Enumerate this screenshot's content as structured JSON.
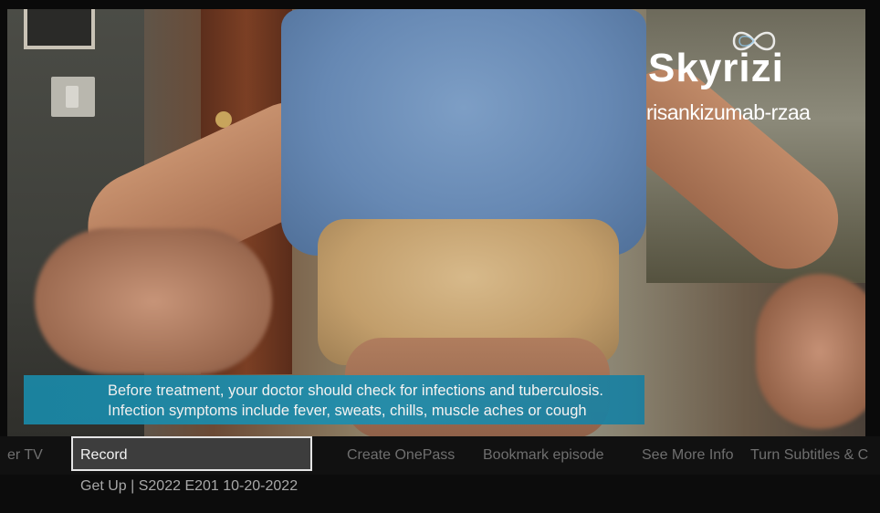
{
  "video": {
    "brand_name": "Skyrizi",
    "generic_name": "risankizumab-rzaa",
    "disclaimer_line1": "Before treatment, your doctor should check for infections and tuberculosis.",
    "disclaimer_line2": "Infection symptoms include fever, sweats, chills, muscle aches or cough"
  },
  "menu": {
    "items": [
      {
        "label": "er TV",
        "focused": false
      },
      {
        "label": "Record",
        "focused": true
      },
      {
        "label": "Create OnePass",
        "focused": false
      },
      {
        "label": "Bookmark episode",
        "focused": false
      },
      {
        "label": "See More Info",
        "focused": false
      },
      {
        "label": "Turn Subtitles & C",
        "focused": false
      }
    ]
  },
  "episode": {
    "info": "Get Up | S2022 E201 10-20-2022"
  },
  "colors": {
    "banner": "#1d8fb0",
    "menu_bg": "#111111",
    "focus_border": "#e5e5e5",
    "focus_bg": "#3d3d3d",
    "menu_text": "#6f6f6f"
  },
  "icons": {
    "brand_logo": "infinity-loop-icon"
  }
}
